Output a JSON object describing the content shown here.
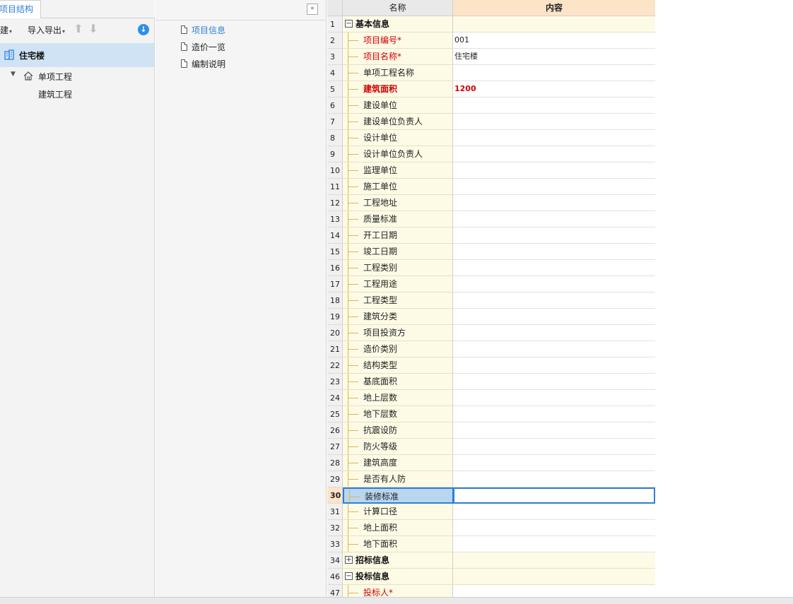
{
  "left": {
    "tab_label": "项目结构",
    "toolbar": {
      "new_label": "新建",
      "import_export_label": "导入导出"
    },
    "tree": {
      "root_label": "住宅楼",
      "child_label": "单项工程",
      "grandchild_label": "建筑工程"
    }
  },
  "middle": {
    "items": [
      {
        "label": "项目信息",
        "active": true
      },
      {
        "label": "造价一览",
        "active": false
      },
      {
        "label": "编制说明",
        "active": false
      }
    ]
  },
  "grid": {
    "headers": {
      "name": "名称",
      "content": "内容"
    },
    "selected_row": "30",
    "rows": [
      {
        "num": "1",
        "name": "基本信息",
        "value": "",
        "group": true,
        "expanded": true
      },
      {
        "num": "2",
        "name": "项目编号*",
        "value": "001",
        "red": true
      },
      {
        "num": "3",
        "name": "项目名称*",
        "value": "住宅楼",
        "red": true
      },
      {
        "num": "4",
        "name": "单项工程名称",
        "value": ""
      },
      {
        "num": "5",
        "name": "建筑面积",
        "value": "1200",
        "red": true,
        "bold": true
      },
      {
        "num": "6",
        "name": "建设单位",
        "value": ""
      },
      {
        "num": "7",
        "name": "建设单位负责人",
        "value": ""
      },
      {
        "num": "8",
        "name": "设计单位",
        "value": ""
      },
      {
        "num": "9",
        "name": "设计单位负责人",
        "value": ""
      },
      {
        "num": "10",
        "name": "监理单位",
        "value": ""
      },
      {
        "num": "11",
        "name": "施工单位",
        "value": ""
      },
      {
        "num": "12",
        "name": "工程地址",
        "value": ""
      },
      {
        "num": "13",
        "name": "质量标准",
        "value": ""
      },
      {
        "num": "14",
        "name": "开工日期",
        "value": ""
      },
      {
        "num": "15",
        "name": "竣工日期",
        "value": ""
      },
      {
        "num": "16",
        "name": "工程类别",
        "value": ""
      },
      {
        "num": "17",
        "name": "工程用途",
        "value": ""
      },
      {
        "num": "18",
        "name": "工程类型",
        "value": ""
      },
      {
        "num": "19",
        "name": "建筑分类",
        "value": ""
      },
      {
        "num": "20",
        "name": "项目投资方",
        "value": ""
      },
      {
        "num": "21",
        "name": "造价类别",
        "value": ""
      },
      {
        "num": "22",
        "name": "结构类型",
        "value": ""
      },
      {
        "num": "23",
        "name": "基底面积",
        "value": ""
      },
      {
        "num": "24",
        "name": "地上层数",
        "value": ""
      },
      {
        "num": "25",
        "name": "地下层数",
        "value": ""
      },
      {
        "num": "26",
        "name": "抗震设防",
        "value": ""
      },
      {
        "num": "27",
        "name": "防火等级",
        "value": ""
      },
      {
        "num": "28",
        "name": "建筑高度",
        "value": ""
      },
      {
        "num": "29",
        "name": "是否有人防",
        "value": ""
      },
      {
        "num": "30",
        "name": "装修标准",
        "value": ""
      },
      {
        "num": "31",
        "name": "计算口径",
        "value": ""
      },
      {
        "num": "32",
        "name": "地上面积",
        "value": ""
      },
      {
        "num": "33",
        "name": "地下面积",
        "value": ""
      },
      {
        "num": "34",
        "name": "招标信息",
        "value": "",
        "group": true,
        "expanded": false
      },
      {
        "num": "46",
        "name": "投标信息",
        "value": "",
        "group": true,
        "expanded": true
      },
      {
        "num": "47",
        "name": "投标人*",
        "value": "",
        "red": true
      }
    ]
  }
}
